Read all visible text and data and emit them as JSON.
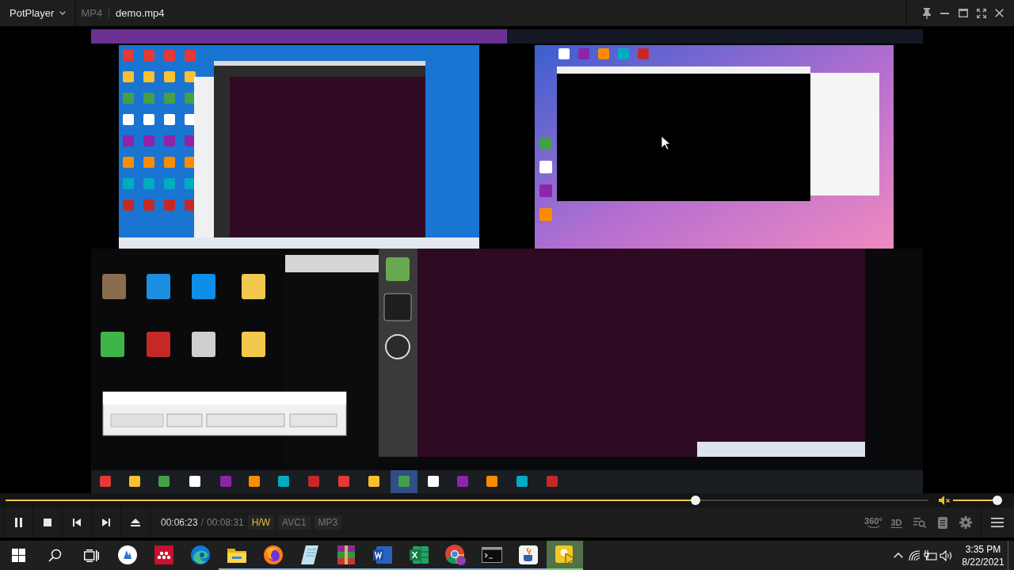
{
  "title_bar": {
    "app_menu": "PotPlayer",
    "format": "MP4",
    "file_name": "demo.mp4"
  },
  "seek_bar": {
    "level": 0.75
  },
  "volume": {
    "muted": true,
    "level": 1
  },
  "controls": {
    "playing": true,
    "position": "00:06:23",
    "separator": "/",
    "duration": "00:08:31",
    "codec_badges": [
      {
        "label": "H/W",
        "on": true
      },
      {
        "label": "AVC1",
        "on": false
      },
      {
        "label": "MP3",
        "on": false
      }
    ],
    "view_buttons": [
      "360°",
      "3D"
    ]
  },
  "taskbar": {
    "apps": [
      {
        "running": false,
        "selected": false
      },
      {
        "running": false,
        "selected": false
      },
      {
        "running": false,
        "selected": false
      },
      {
        "running": true,
        "selected": false
      },
      {
        "running": true,
        "selected": false
      },
      {
        "running": true,
        "selected": false
      },
      {
        "running": true,
        "selected": false
      },
      {
        "running": true,
        "selected": false
      },
      {
        "running": true,
        "selected": false
      },
      {
        "running": true,
        "selected": false
      },
      {
        "running": true,
        "selected": false
      },
      {
        "running": true,
        "selected": false
      },
      {
        "running": true,
        "selected": true
      }
    ],
    "clock": {
      "time": "3:35 PM",
      "date": "8/22/2021"
    }
  }
}
